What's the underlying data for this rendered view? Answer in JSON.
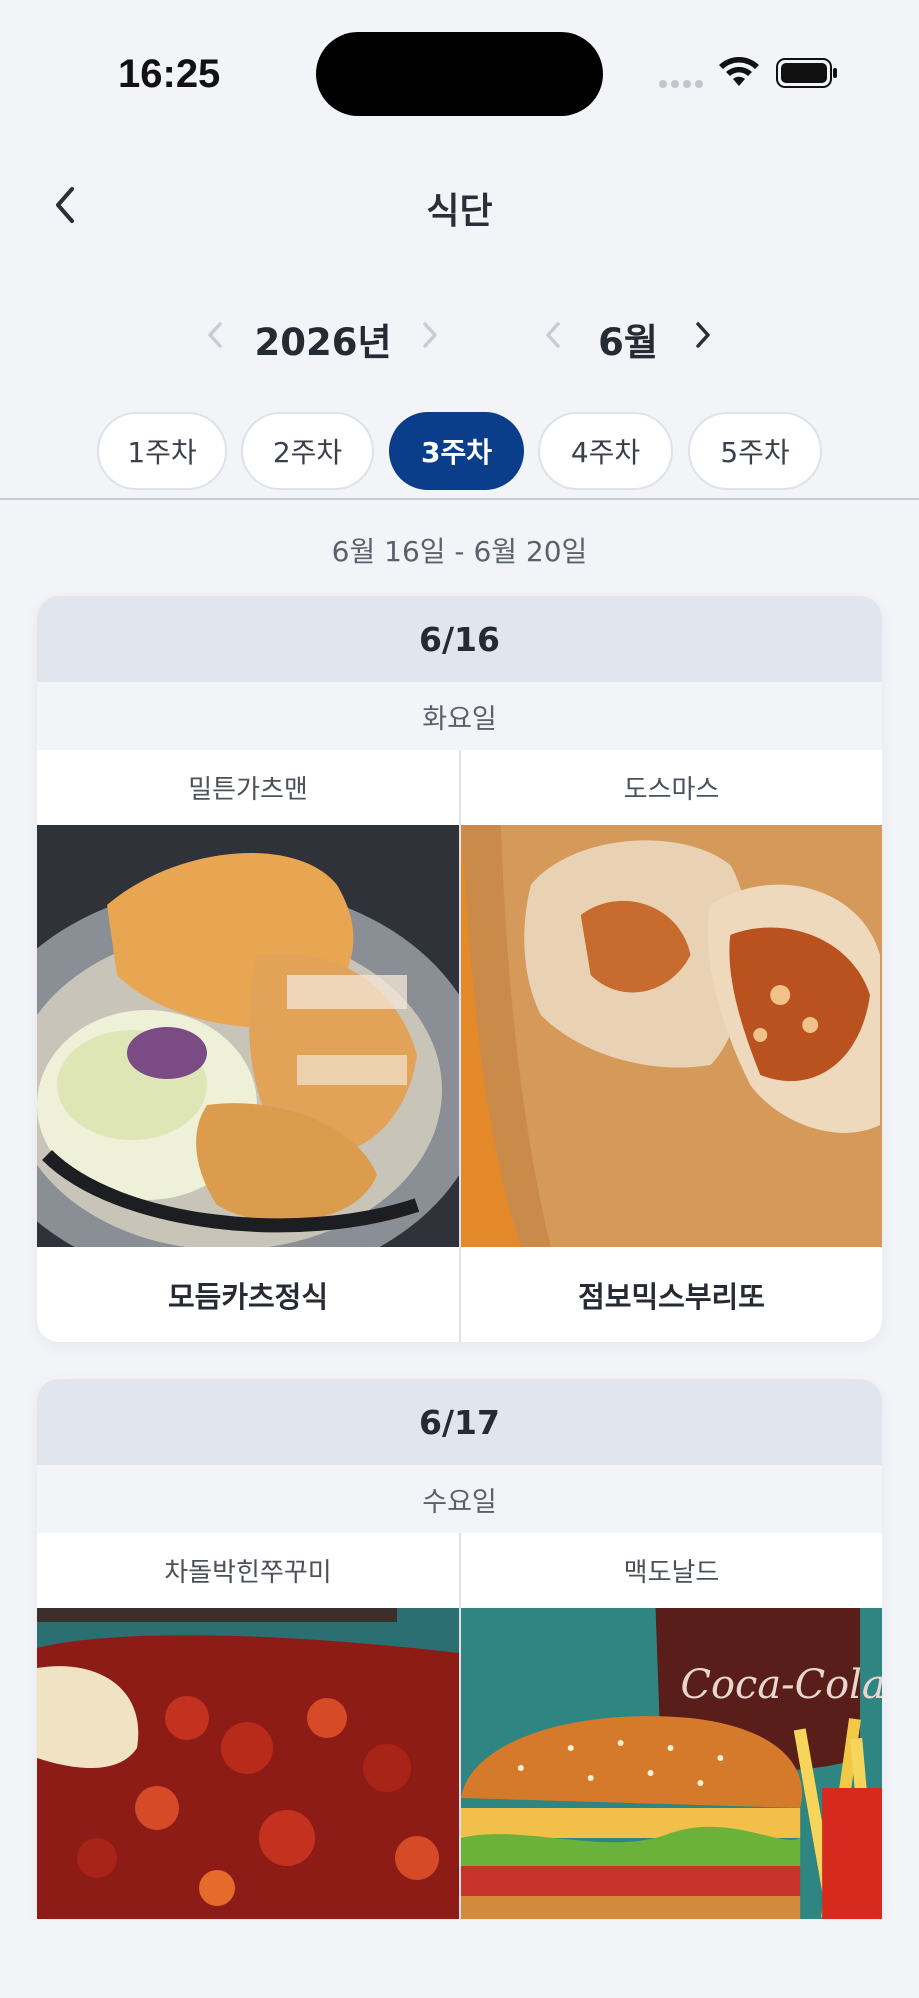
{
  "status_bar": {
    "time": "16:25"
  },
  "nav": {
    "title": "식단"
  },
  "selector": {
    "year": "2026년",
    "month": "6월"
  },
  "week_tabs": [
    {
      "label": "1주차",
      "active": false
    },
    {
      "label": "2주차",
      "active": false
    },
    {
      "label": "3주차",
      "active": true
    },
    {
      "label": "4주차",
      "active": false
    },
    {
      "label": "5주차",
      "active": false
    }
  ],
  "range_label": "6월 16일 - 6월 20일",
  "days": [
    {
      "date": "6/16",
      "weekday": "화요일",
      "menus": [
        {
          "restaurant": "밀튼가츠맨",
          "dish": "모듬카츠정식",
          "photo": "pork-cutlet-photo"
        },
        {
          "restaurant": "도스마스",
          "dish": "점보믹스부리또",
          "photo": "burrito-photo"
        }
      ]
    },
    {
      "date": "6/17",
      "weekday": "수요일",
      "menus": [
        {
          "restaurant": "차돌박힌쭈꾸미",
          "dish": "",
          "photo": "spicy-webfoot-octopus-photo"
        },
        {
          "restaurant": "맥도날드",
          "dish": "",
          "photo": "burger-cola-photo",
          "photo_text": "Coca-Cola"
        }
      ]
    }
  ],
  "colors": {
    "background": "#f2f4f8",
    "accent": "#0a3d8a",
    "date_header": "#e1e5ee"
  }
}
